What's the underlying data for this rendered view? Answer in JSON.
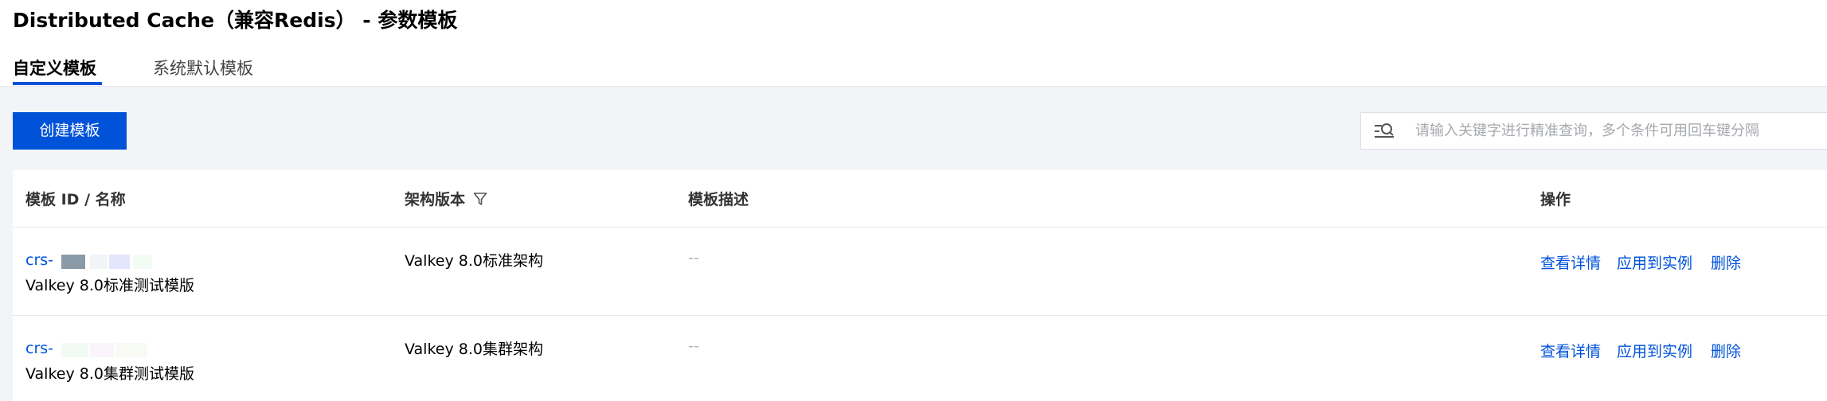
{
  "page": {
    "title": "Distributed Cache（兼容Redis） - 参数模板"
  },
  "tabs": [
    {
      "label": "自定义模板",
      "active": true
    },
    {
      "label": "系统默认模板",
      "active": false
    }
  ],
  "toolbar": {
    "create_label": "创建模板",
    "search_placeholder": "请输入关键字进行精准查询，多个条件可用回车键分隔",
    "search_value": ""
  },
  "table": {
    "headers": {
      "id_name": "模板 ID / 名称",
      "arch_version": "架构版本",
      "description": "模板描述",
      "actions": "操作"
    },
    "rows": [
      {
        "id_prefix": "crs-",
        "name": "Valkey 8.0标准测试模版",
        "arch_version": "Valkey 8.0标准架构",
        "description": "--",
        "actions": {
          "detail": "查看详情",
          "apply": "应用到实例",
          "delete": "删除"
        }
      },
      {
        "id_prefix": "crs-",
        "name": "Valkey 8.0集群测试模版",
        "arch_version": "Valkey 8.0集群架构",
        "description": "--",
        "actions": {
          "detail": "查看详情",
          "apply": "应用到实例",
          "delete": "删除"
        }
      }
    ]
  },
  "colors": {
    "accent": "#0052d9",
    "background": "#f3f4f7",
    "muted_text": "#b0b3b8"
  },
  "icons": {
    "search": "search-icon",
    "filter": "filter-icon"
  }
}
